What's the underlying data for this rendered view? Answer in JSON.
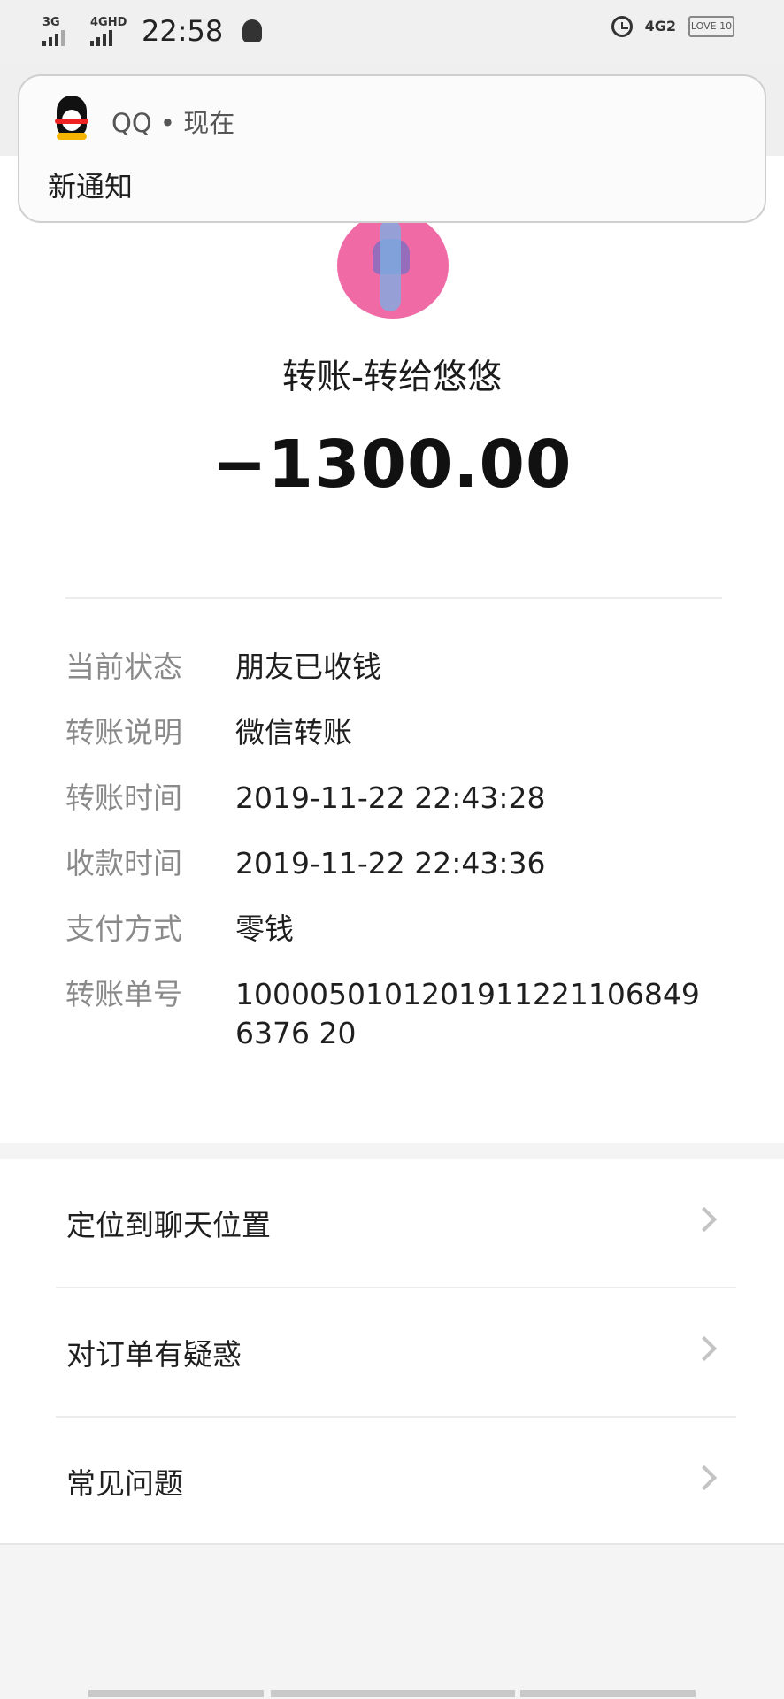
{
  "status_bar": {
    "signal1_label": "3G",
    "signal2_label": "4GHD",
    "time": "22:58",
    "network_label": "4G2",
    "battery_label": "LOVE 10"
  },
  "notification": {
    "app": "QQ • 现在",
    "text": "新通知"
  },
  "transfer": {
    "title": "转账-转给悠悠",
    "amount": "−1300.00"
  },
  "details": [
    {
      "label": "当前状态",
      "value": "朋友已收钱"
    },
    {
      "label": "转账说明",
      "value": "微信转账"
    },
    {
      "label": "转账时间",
      "value": "2019-11-22 22:43:28"
    },
    {
      "label": "收款时间",
      "value": "2019-11-22 22:43:36"
    },
    {
      "label": "支付方式",
      "value": "零钱"
    },
    {
      "label": "转账单号",
      "value": "10000501012019112211068496376 20"
    }
  ],
  "menu": [
    {
      "label": "定位到聊天位置"
    },
    {
      "label": "对订单有疑惑"
    },
    {
      "label": "常见问题"
    }
  ],
  "colors": {
    "avatar_bg": "#f06aa6",
    "label_gray": "#8a8a8a",
    "page_bg": "#f4f4f4"
  },
  "icons": [
    "signal-icon",
    "qq-status-icon",
    "alarm-icon",
    "battery-icon",
    "qq-logo-icon",
    "chevron-right-icon"
  ]
}
